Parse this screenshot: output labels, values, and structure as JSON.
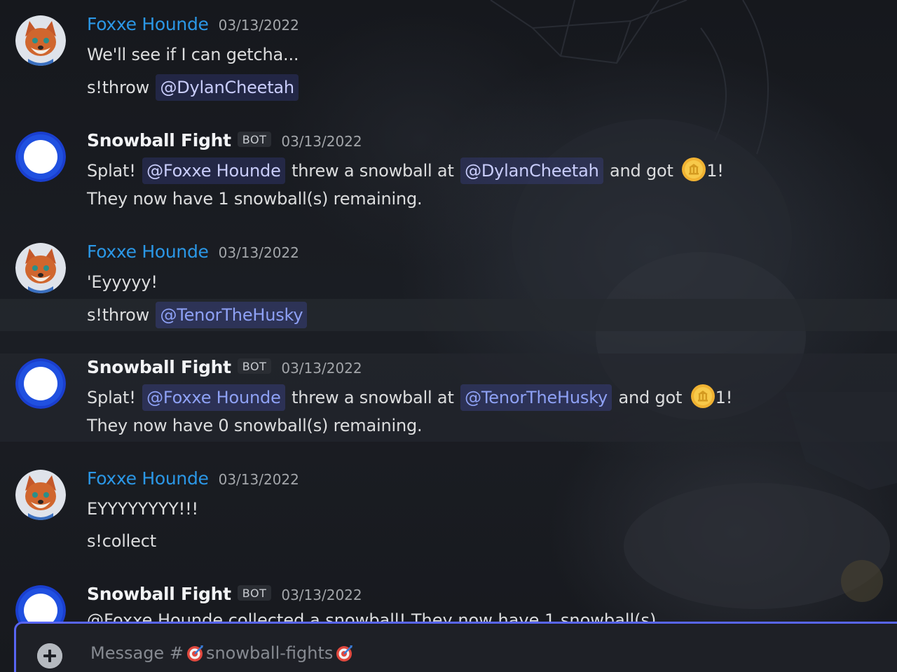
{
  "channel": {
    "placeholder_prefix": "Message #",
    "channel_name": "snowball-fights"
  },
  "messages": [
    {
      "author": "Foxxe Hounde",
      "timestamp": "03/13/2022",
      "lines": [
        "We'll see if I can getcha...",
        "s!throw"
      ],
      "mention": "@DylanCheetah"
    },
    {
      "author": "Snowball Fight",
      "bot_tag": "BOT",
      "timestamp": "03/13/2022",
      "splat": "Splat!",
      "thrower": "@Foxxe Hounde",
      "threw_text": "threw a snowball at",
      "target": "@DylanCheetah",
      "and_got": "and got",
      "reward": "1!",
      "remaining": "They now have 1 snowball(s) remaining."
    },
    {
      "author": "Foxxe Hounde",
      "timestamp": "03/13/2022",
      "lines": [
        "'Eyyyyy!",
        "s!throw"
      ],
      "mention": "@TenorTheHusky"
    },
    {
      "author": "Snowball Fight",
      "bot_tag": "BOT",
      "timestamp": "03/13/2022",
      "splat": "Splat!",
      "thrower": "@Foxxe Hounde",
      "threw_text": "threw a snowball at",
      "target": "@TenorTheHusky",
      "and_got": "and got",
      "reward": "1!",
      "remaining": "They now have 0 snowball(s) remaining."
    },
    {
      "author": "Foxxe Hounde",
      "timestamp": "03/13/2022",
      "lines": [
        "EYYYYYYYY!!!",
        "s!collect"
      ]
    },
    {
      "author": "Snowball Fight",
      "bot_tag": "BOT",
      "timestamp": "03/13/2022",
      "partial_text": "@Foxxe Hounde  collected a snowball! They now have 1 snowball(s)"
    }
  ],
  "colors": {
    "accent": "#5865f2",
    "fox_name": "#2b97e6",
    "mention_text": "#c9cdfb",
    "coin": "#f0b232"
  },
  "icons": {
    "add": "plus-circle-icon",
    "channel_emoji": "target-icon",
    "coin": "coin-icon"
  }
}
